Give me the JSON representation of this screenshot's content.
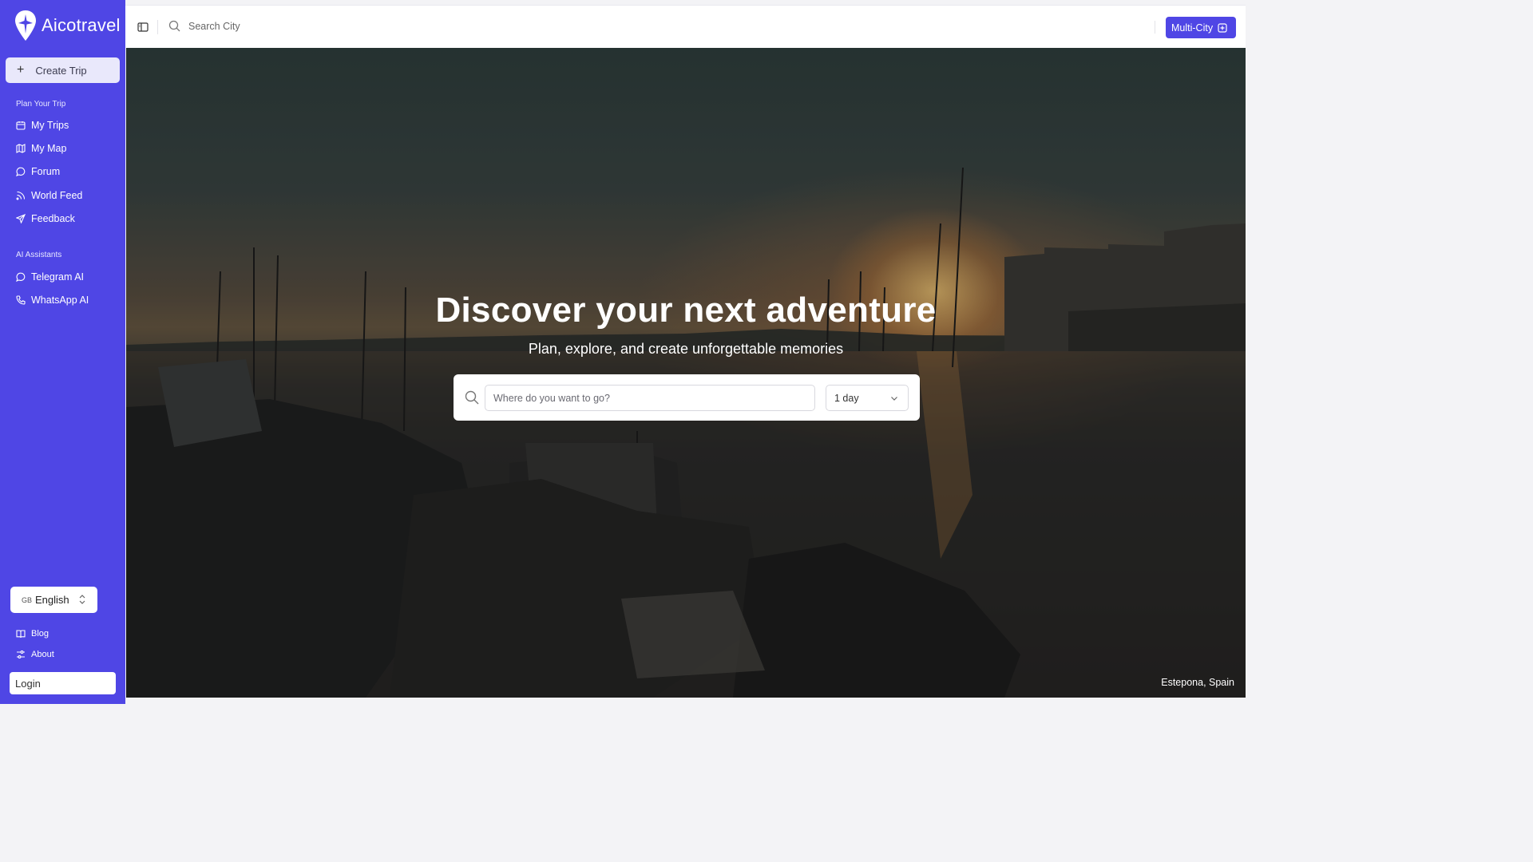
{
  "brand": {
    "name": "Aicotravel"
  },
  "sidebar": {
    "create_trip": "Create Trip",
    "plan_section": "Plan Your Trip",
    "plan_items": [
      {
        "label": "My Trips",
        "icon": "calendar-icon"
      },
      {
        "label": "My Map",
        "icon": "map-icon"
      },
      {
        "label": "Forum",
        "icon": "chat-bubble-icon"
      },
      {
        "label": "World Feed",
        "icon": "rss-icon"
      },
      {
        "label": "Feedback",
        "icon": "send-icon"
      }
    ],
    "ai_section": "AI Assistants",
    "ai_items": [
      {
        "label": "Telegram AI",
        "icon": "chat-bubble-icon"
      },
      {
        "label": "WhatsApp AI",
        "icon": "phone-icon"
      }
    ],
    "language": "English",
    "bottom_items": [
      {
        "label": "Blog",
        "icon": "book-icon"
      },
      {
        "label": "About",
        "icon": "sliders-icon"
      }
    ],
    "login": "Login"
  },
  "topbar": {
    "search_placeholder": "Search City",
    "multi_city": "Multi-City"
  },
  "hero": {
    "title": "Discover your next adventure",
    "subtitle": "Plan, explore, and create unforgettable memories",
    "destination_placeholder": "Where do you want to go?",
    "duration": "1 day",
    "photo_caption": "Estepona, Spain"
  },
  "colors": {
    "brand": "#4f46e5",
    "button_light": "#e9e8fb"
  }
}
